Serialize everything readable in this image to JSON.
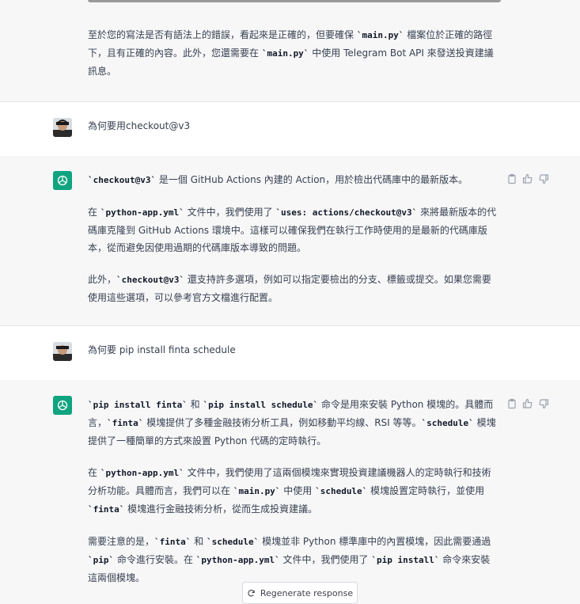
{
  "blocks": {
    "b0": {
      "p1": "至於您的寫法是否有語法上的錯誤，看起來是正確的，但要確保 `main.py` 檔案位於正確的路徑下，且有正確的內容。此外，您還需要在 `main.py` 中使用 Telegram Bot API 來發送投資建議訊息。"
    },
    "u1": {
      "text": "為何要用checkout@v3"
    },
    "a1": {
      "p1": "`checkout@v3` 是一個 GitHub Actions 內建的 Action，用於檢出代碼庫中的最新版本。",
      "p2": "在 `python-app.yml` 文件中，我們使用了 `uses: actions/checkout@v3` 來將最新版本的代碼庫克隆到 GitHub Actions 環境中。這樣可以確保我們在執行工作時使用的是最新的代碼庫版本，從而避免因使用過期的代碼庫版本導致的問題。",
      "p3": "此外，`checkout@v3` 還支持許多選項，例如可以指定要檢出的分支、標籤或提交。如果您需要使用這些選項，可以參考官方文檔進行配置。"
    },
    "u2": {
      "text": "為何要 pip install finta schedule"
    },
    "a2": {
      "p1": "`pip install finta` 和 `pip install schedule` 命令是用來安裝 Python 模塊的。具體而言，`finta` 模塊提供了多種金融技術分析工具，例如移動平均線、RSI 等等。`schedule` 模塊提供了一種簡單的方式來設置 Python 代碼的定時執行。",
      "p2": "在 `python-app.yml` 文件中，我們使用了這兩個模塊來實現投資建議機器人的定時執行和技術分析功能。具體而言，我們可以在 `main.py` 中使用 `schedule` 模塊設置定時執行，並使用 `finta` 模塊進行金融技術分析，從而生成投資建議。",
      "p3": "需要注意的是，`finta` 和 `schedule` 模塊並非 Python 標準庫中的內置模塊，因此需要通過 `pip` 命令進行安裝。在 `python-app.yml` 文件中，我們使用了 `pip install` 命令來安裝這兩個模塊。"
    }
  },
  "regenerate_label": "Regenerate response",
  "icons": [
    "clipboard-icon",
    "thumbs-up-icon",
    "thumbs-down-icon",
    "refresh-icon",
    "openai-logo-icon"
  ],
  "colors": {
    "gpt_green": "#10a37f",
    "gray_bg": "#f7f7f8",
    "white_bg": "#ffffff"
  }
}
